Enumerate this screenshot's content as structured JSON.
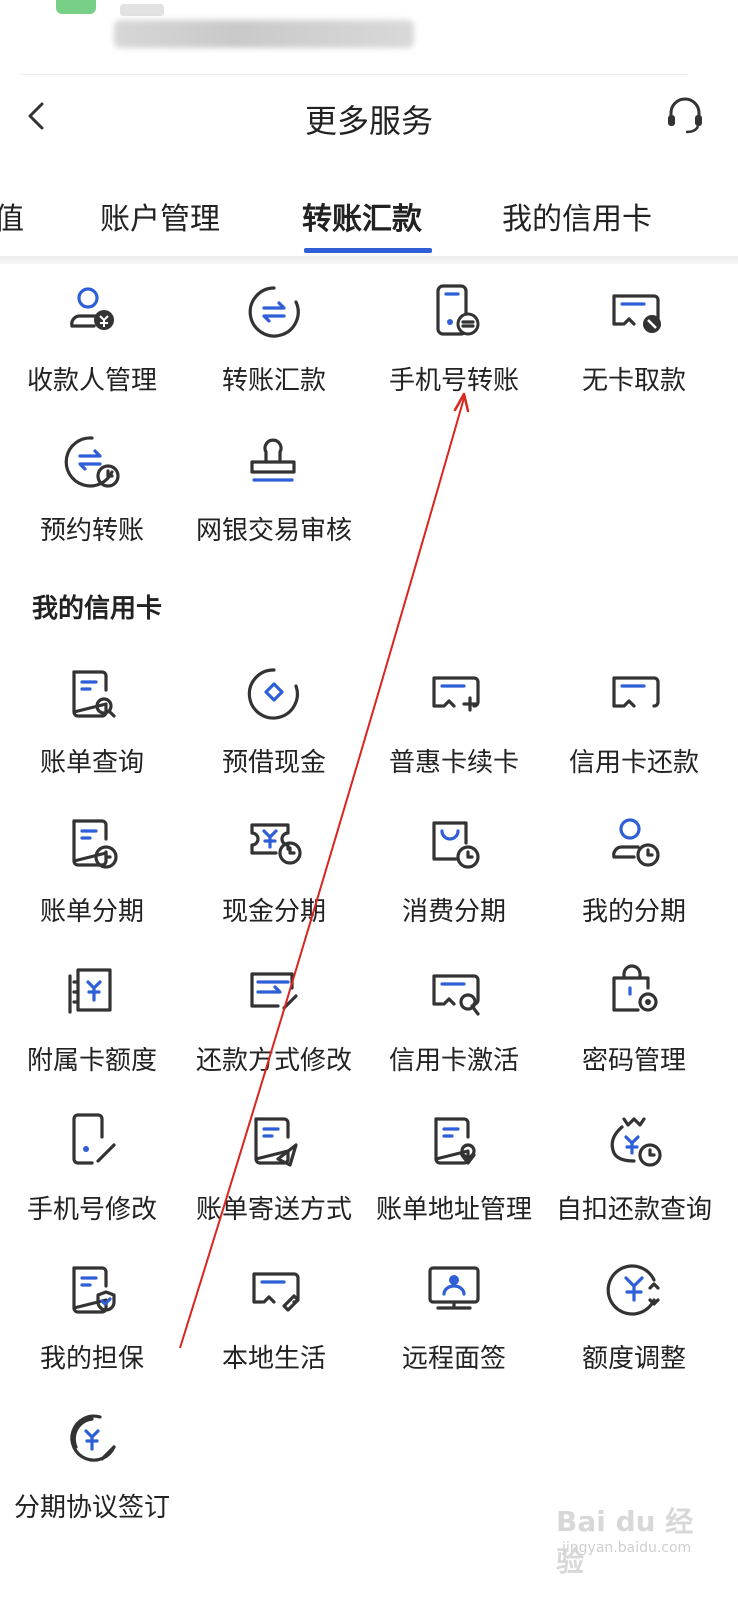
{
  "header": {
    "title": "更多服务"
  },
  "tabs": [
    {
      "label": "值"
    },
    {
      "label": "账户管理"
    },
    {
      "label": "转账汇款"
    },
    {
      "label": "我的信用卡"
    }
  ],
  "transfer_items": [
    {
      "label": "收款人管理",
      "icon": "payee-icon"
    },
    {
      "label": "转账汇款",
      "icon": "transfer-icon"
    },
    {
      "label": "手机号转账",
      "icon": "phone-transfer-icon"
    },
    {
      "label": "无卡取款",
      "icon": "cardless-withdraw-icon"
    },
    {
      "label": "预约转账",
      "icon": "scheduled-transfer-icon"
    },
    {
      "label": "网银交易审核",
      "icon": "stamp-icon"
    }
  ],
  "credit_section": {
    "title": "我的信用卡"
  },
  "credit_items": [
    {
      "label": "账单查询",
      "icon": "bill-search-icon"
    },
    {
      "label": "预借现金",
      "icon": "cash-advance-icon"
    },
    {
      "label": "普惠卡续卡",
      "icon": "card-renew-icon"
    },
    {
      "label": "信用卡还款",
      "icon": "card-repay-icon"
    },
    {
      "label": "账单分期",
      "icon": "bill-installment-icon"
    },
    {
      "label": "现金分期",
      "icon": "cash-installment-icon"
    },
    {
      "label": "消费分期",
      "icon": "purchase-installment-icon"
    },
    {
      "label": "我的分期",
      "icon": "my-installment-icon"
    },
    {
      "label": "附属卡额度",
      "icon": "supplementary-card-icon"
    },
    {
      "label": "还款方式修改",
      "icon": "repay-method-icon"
    },
    {
      "label": "信用卡激活",
      "icon": "card-activate-icon"
    },
    {
      "label": "密码管理",
      "icon": "password-lock-icon"
    },
    {
      "label": "手机号修改",
      "icon": "phone-edit-icon"
    },
    {
      "label": "账单寄送方式",
      "icon": "bill-send-icon"
    },
    {
      "label": "账单地址管理",
      "icon": "bill-address-icon"
    },
    {
      "label": "自扣还款查询",
      "icon": "autopay-query-icon"
    },
    {
      "label": "我的担保",
      "icon": "guarantee-icon"
    },
    {
      "label": "本地生活",
      "icon": "local-life-icon"
    },
    {
      "label": "远程面签",
      "icon": "remote-sign-icon"
    },
    {
      "label": "额度调整",
      "icon": "limit-adjust-icon"
    },
    {
      "label": "分期协议签订",
      "icon": "agreement-sign-icon"
    }
  ],
  "colors": {
    "accent": "#2f5fd6",
    "icon_stroke": "#333333",
    "annotation_arrow": "#d9251d"
  },
  "watermark": {
    "text": "Bai du 经验",
    "sub": "jingyan.baidu.com"
  }
}
